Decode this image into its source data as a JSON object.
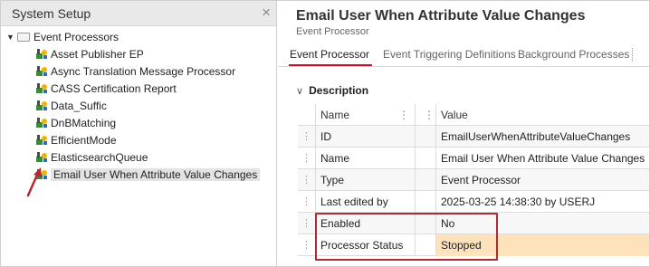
{
  "left_panel": {
    "title": "System Setup",
    "close_symbol": "×",
    "tree": {
      "root_label": "Event Processors",
      "items": [
        {
          "label": "Asset Publisher EP"
        },
        {
          "label": "Async Translation Message Processor"
        },
        {
          "label": "CASS Certification Report"
        },
        {
          "label": "Data_Suffic"
        },
        {
          "label": "DnBMatching"
        },
        {
          "label": "EfficientMode"
        },
        {
          "label": "ElasticsearchQueue"
        },
        {
          "label": "Email User When Attribute Value Changes",
          "selected": true
        }
      ]
    }
  },
  "right_panel": {
    "title": "Email User When Attribute Value Changes",
    "subtitle": "Event Processor",
    "tabs": [
      {
        "label": "Event Processor",
        "active": true
      },
      {
        "label": "Event Triggering Definitions"
      },
      {
        "label": "Background Processes"
      }
    ],
    "section": {
      "label": "Description"
    },
    "grid": {
      "header": {
        "name": "Name",
        "value": "Value"
      },
      "rows": [
        {
          "name": "ID",
          "value": "EmailUserWhenAttributeValueChanges"
        },
        {
          "name": "Name",
          "value": "Email User When Attribute Value Changes"
        },
        {
          "name": "Type",
          "value": "Event Processor"
        },
        {
          "name": "Last edited by",
          "value": "2025-03-25 14:38:30 by USERJ"
        },
        {
          "name": "Enabled",
          "value": "No"
        },
        {
          "name": "Processor Status",
          "value": "Stopped"
        }
      ]
    }
  },
  "colors": {
    "tab_underline": "#c8102e",
    "highlight_box": "#b22a31",
    "annotation_arrow": "#b22a31",
    "stopped_bg": "#fde2bb"
  }
}
